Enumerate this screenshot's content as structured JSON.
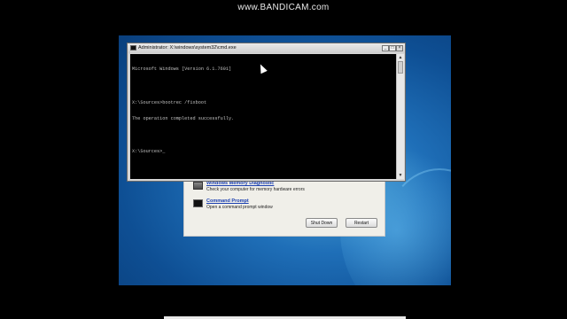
{
  "watermark": "www.BANDICAM.com",
  "cmd": {
    "title": "Administrator: X:\\windows\\system32\\cmd.exe",
    "lines": [
      "Microsoft Windows [Version 6.1.7601]",
      "",
      "X:\\Sources>bootrec /fixboot",
      "The operation completed successfully.",
      "",
      "X:\\Sources>_"
    ],
    "minimize": "_",
    "maximize": "□",
    "close": "×",
    "scroll_up": "▲",
    "scroll_down": "▼"
  },
  "recovery": {
    "items": [
      {
        "link": "Windows Memory Diagnostic",
        "desc": "Check your computer for memory hardware errors",
        "icon": "memory-chip-icon"
      },
      {
        "link": "Command Prompt",
        "desc": "Open a command prompt window",
        "icon": "command-prompt-icon"
      }
    ],
    "shutdown_label": "Shut Down",
    "restart_label": "Restart"
  }
}
